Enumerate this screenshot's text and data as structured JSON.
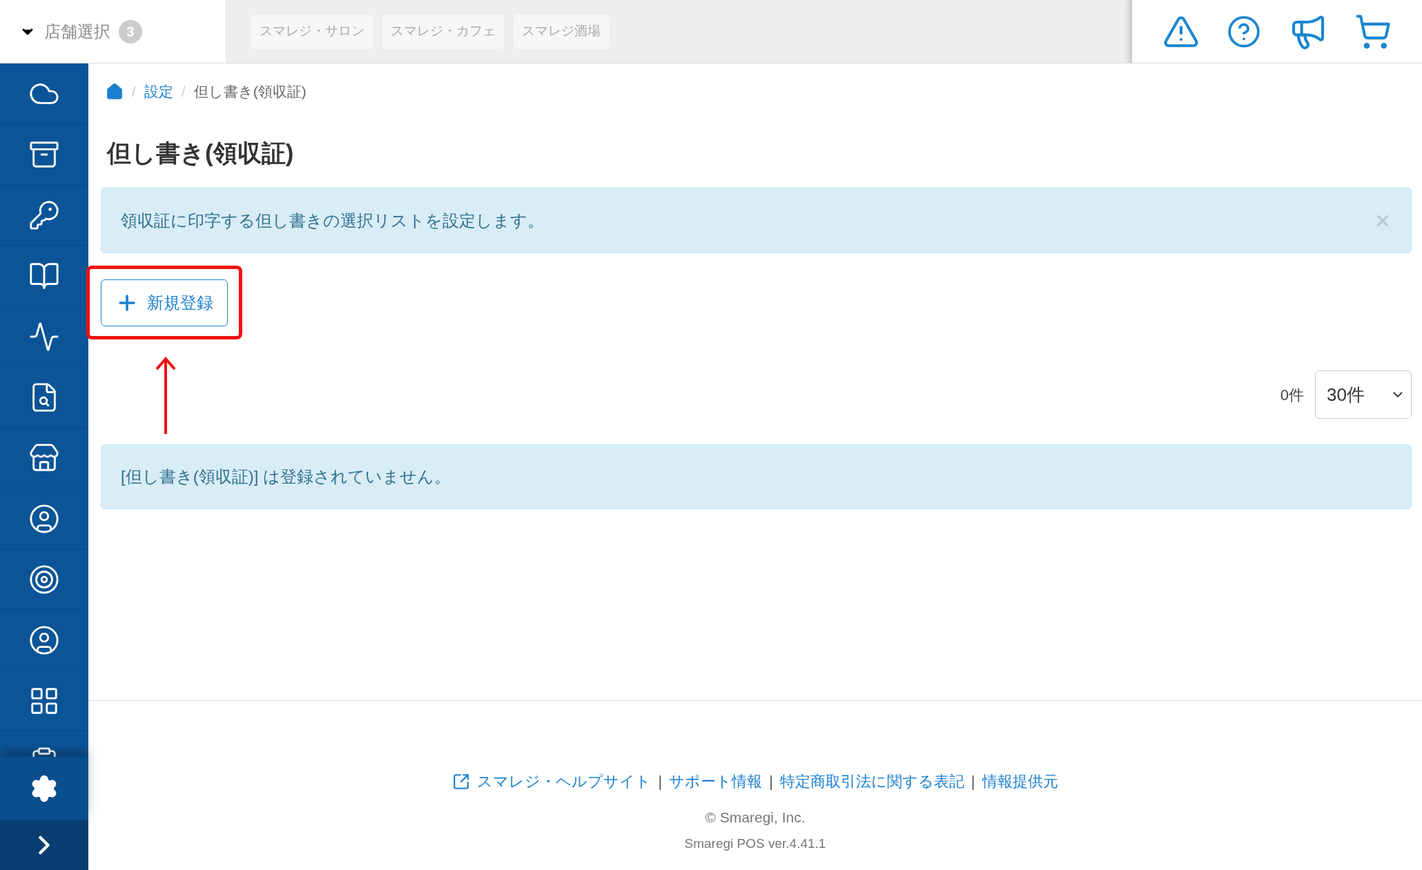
{
  "header": {
    "store_selector": {
      "label": "店舗選択",
      "count": "3"
    },
    "store_tabs": [
      "スマレジ・サロン",
      "スマレジ・カフェ",
      "スマレジ酒場"
    ]
  },
  "breadcrumb": {
    "separator": "/",
    "items": [
      {
        "label": "設定",
        "kind": "link"
      },
      {
        "label": "但し書き(領収証)",
        "kind": "current"
      }
    ]
  },
  "page_title": "但し書き(領収証)",
  "info_alert": {
    "text": "領収証に印字する但し書きの選択リストを設定します。",
    "dismissible": true
  },
  "new_button": {
    "label": "新規登録"
  },
  "pagination": {
    "total": "0件",
    "page_size": "30件"
  },
  "empty_alert": {
    "text": "[但し書き(領収証)] は登録されていません。"
  },
  "footer": {
    "separator": "|",
    "links": [
      "スマレジ・ヘルプサイト",
      "サポート情報",
      "特定商取引法に関する表記",
      "情報提供元"
    ],
    "copyright": "© Smaregi, Inc.",
    "version": "Smaregi POS ver.4.41.1"
  }
}
